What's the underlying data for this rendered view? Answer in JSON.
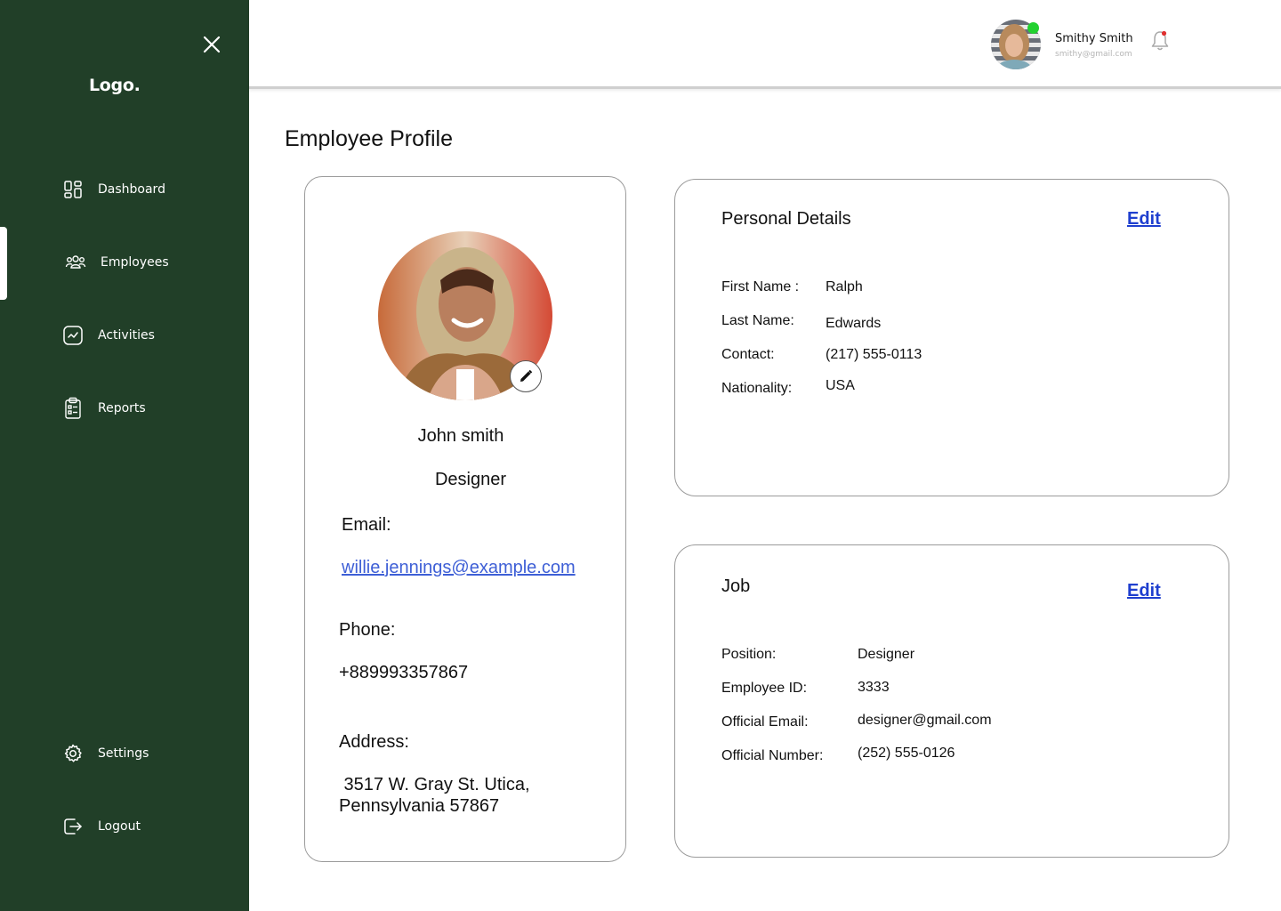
{
  "sidebar": {
    "logo": "Logo.",
    "items": [
      {
        "label": "Dashboard",
        "icon": "dashboard-icon"
      },
      {
        "label": "Employees",
        "icon": "employees-icon"
      },
      {
        "label": "Activities",
        "icon": "activity-chart-icon"
      },
      {
        "label": "Reports",
        "icon": "clipboard-report-icon"
      },
      {
        "label": "Settings",
        "icon": "gear-icon"
      },
      {
        "label": "Logout",
        "icon": "logout-icon"
      }
    ],
    "active_item": "Employees",
    "background_color": "#213f28"
  },
  "header": {
    "user_name": "Smithy Smith",
    "user_email": "smithy@gmail.com",
    "online_color": "#22d12f",
    "notification_color": "#e03030"
  },
  "page": {
    "title": "Employee Profile"
  },
  "profile": {
    "name": "John smith",
    "role": "Designer",
    "email_label": "Email:",
    "email": "willie.jennings@example.com",
    "phone_label": "Phone:",
    "phone": "+889993357867",
    "address_label": "Address:",
    "address_line1": " 3517 W. Gray St. Utica,",
    "address_line2": "Pennsylvania 57867"
  },
  "personal": {
    "title": "Personal Details",
    "edit_label": "Edit",
    "fields": [
      {
        "label": "First Name :",
        "value": "Ralph"
      },
      {
        "label": "Last Name:",
        "value": "Edwards"
      },
      {
        "label": "Contact:",
        "value": "(217) 555-0113"
      },
      {
        "label": "Nationality:",
        "value": "USA"
      }
    ]
  },
  "job": {
    "title": "Job",
    "edit_label": "Edit",
    "fields": [
      {
        "label": "Position:",
        "value": "Designer"
      },
      {
        "label": "Employee ID:",
        "value": "3333"
      },
      {
        "label": "Official Email:",
        "value": "designer@gmail.com"
      },
      {
        "label": "Official Number:",
        "value": "(252) 555-0126"
      }
    ]
  }
}
